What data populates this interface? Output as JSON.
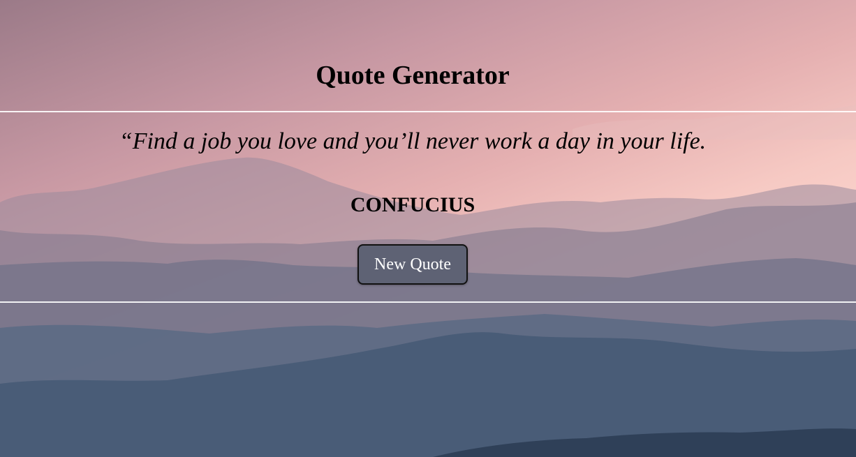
{
  "header": {
    "title": "Quote Generator"
  },
  "quote": {
    "text": "“Find a job you love and you’ll never work a day in your life.",
    "author": "CONFUCIUS"
  },
  "actions": {
    "new_quote_label": "New Quote"
  },
  "colors": {
    "button_bg": "#5e6274",
    "divider": "#ffffff",
    "sky_top": "#9b7a88",
    "sky_glow": "#fbd3cc",
    "mountain_far": "#8a7f93",
    "mountain_near": "#3c4e68"
  }
}
